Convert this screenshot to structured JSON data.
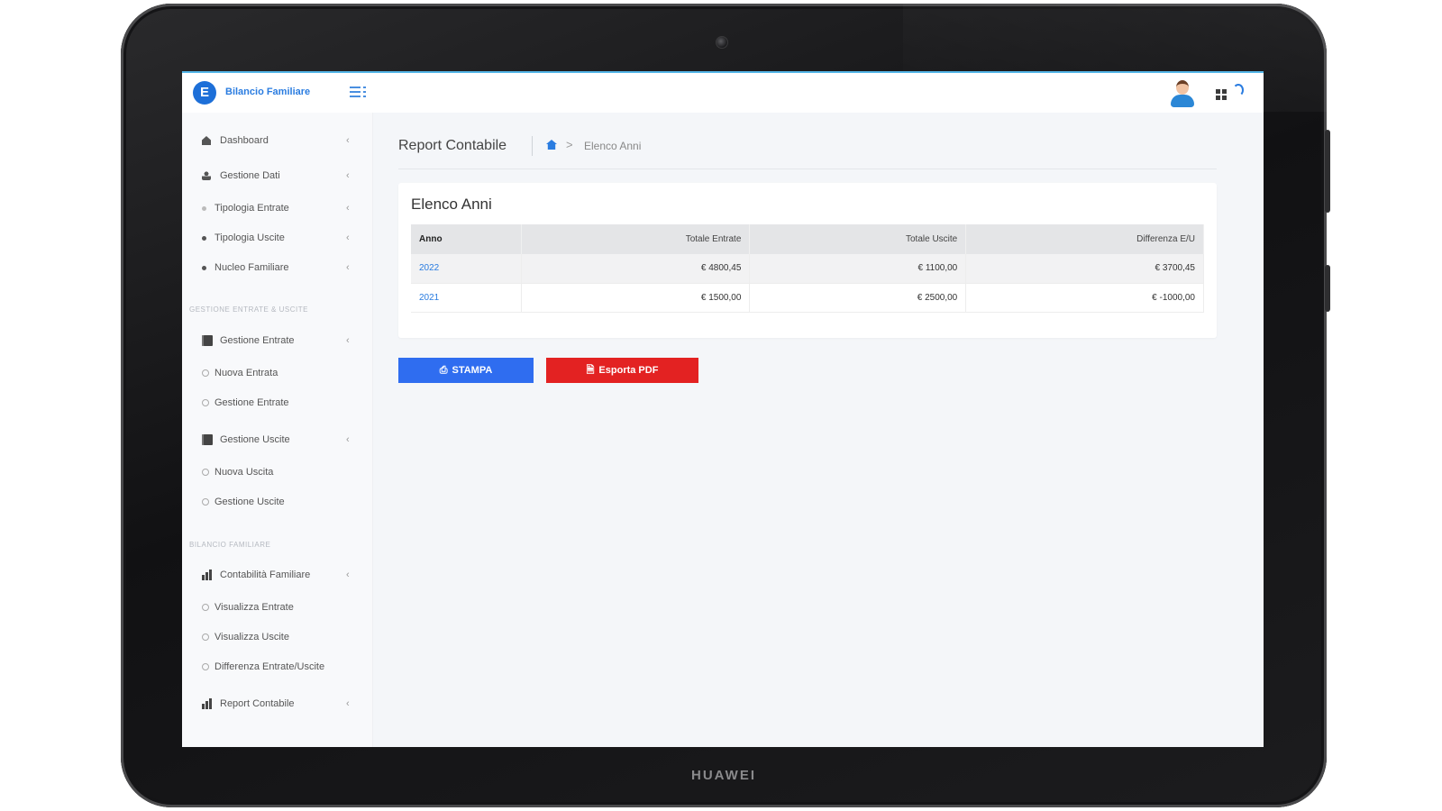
{
  "device": {
    "brand": "HUAWEI"
  },
  "header": {
    "logo_letter": "E",
    "app_name": "Bilancio Familiare"
  },
  "sidebar": {
    "items": [
      {
        "label": "Dashboard",
        "icon": "home-icon",
        "chevron": "‹"
      },
      {
        "label": "Gestione Dati",
        "icon": "user-icon",
        "chevron": "‹"
      },
      {
        "label": "Tipologia Entrate",
        "icon": "dot-icon",
        "chevron": "‹"
      },
      {
        "label": "Tipologia Uscite",
        "icon": "dot-icon",
        "chevron": "‹"
      },
      {
        "label": "Nucleo Familiare",
        "icon": "dot-icon",
        "chevron": "‹"
      }
    ],
    "section_entrate_uscite": "GESTIONE ENTRATE & USCITE",
    "gestione_entrate": {
      "label": "Gestione Entrate",
      "icon": "book-icon",
      "chevron": "‹"
    },
    "entrate_sub": [
      "Nuova Entrata",
      "Gestione Entrate"
    ],
    "gestione_uscite": {
      "label": "Gestione Uscite",
      "icon": "book-icon",
      "chevron": "‹"
    },
    "uscite_sub": [
      "Nuova Uscita",
      "Gestione Uscite"
    ],
    "section_bilancio": "BILANCIO FAMILIARE",
    "contabilita": {
      "label": "Contabilità Familiare",
      "icon": "chart-icon",
      "chevron": "‹"
    },
    "contabilita_sub": [
      "Visualizza Entrate",
      "Visualizza Uscite",
      "Differenza Entrate/Uscite"
    ],
    "report": {
      "label": "Report Contabile",
      "icon": "chart-icon",
      "chevron": "‹"
    }
  },
  "breadcrumb": {
    "page_title": "Report Contabile",
    "arrow": ">",
    "current": "Elenco Anni"
  },
  "card": {
    "title": "Elenco Anni",
    "columns": [
      "Anno",
      "Totale Entrate",
      "Totale Uscite",
      "Differenza E/U"
    ],
    "rows": [
      {
        "anno": "2022",
        "entrate": "€ 4800,45",
        "uscite": "€ 1100,00",
        "differenza": "€ 3700,45"
      },
      {
        "anno": "2021",
        "entrate": "€ 1500,00",
        "uscite": "€ 2500,00",
        "differenza": "€ -1000,00"
      }
    ]
  },
  "buttons": {
    "print_label": "STAMPA",
    "print_icon": "⎙",
    "pdf_label": "Esporta PDF",
    "pdf_icon": "🗎",
    "print_color": "#2f6df0",
    "pdf_color": "#e32222"
  },
  "colors": {
    "accent": "#2a7ce0",
    "header_border": "#55b6e8"
  }
}
